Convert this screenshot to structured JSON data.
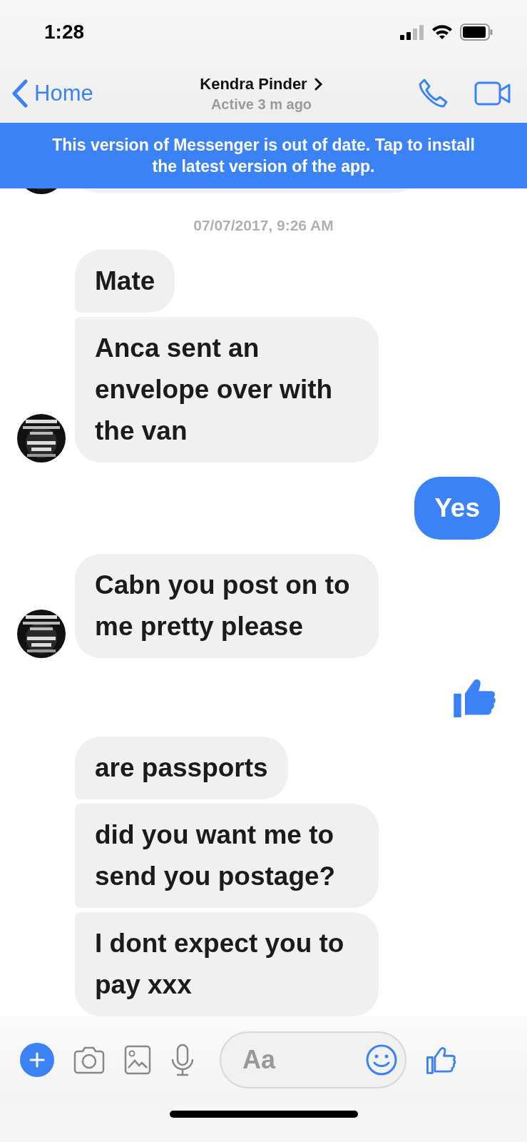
{
  "status_bar": {
    "time": "1:28"
  },
  "header": {
    "back_label": "Home",
    "contact_name": "Kendra Pinder",
    "status": "Active 3 m ago"
  },
  "banner": {
    "text": "This version of Messenger is out of date. Tap to install the latest version of the app."
  },
  "timestamp": "07/07/2017, 9:26 AM",
  "groups": [
    {
      "kind": "incoming",
      "avatar_shown": true,
      "messages": [
        {
          "kind": "text",
          "text": "Mate"
        },
        {
          "kind": "text",
          "text": "Anca sent an envelope over with the van"
        }
      ]
    },
    {
      "kind": "outgoing",
      "messages": [
        {
          "kind": "text",
          "text": "Yes"
        }
      ]
    },
    {
      "kind": "incoming",
      "avatar_shown": true,
      "messages": [
        {
          "kind": "text",
          "text": "Cabn you post on to me pretty please"
        }
      ]
    },
    {
      "kind": "outgoing",
      "messages": [
        {
          "kind": "like"
        }
      ]
    },
    {
      "kind": "incoming",
      "avatar_shown": false,
      "messages": [
        {
          "kind": "text",
          "text": "are passports"
        },
        {
          "kind": "text",
          "text": "did you want me to send you postage?"
        },
        {
          "kind": "text",
          "text": "I dont expect you to pay xxx"
        }
      ]
    }
  ],
  "composer": {
    "placeholder": "Aa"
  }
}
